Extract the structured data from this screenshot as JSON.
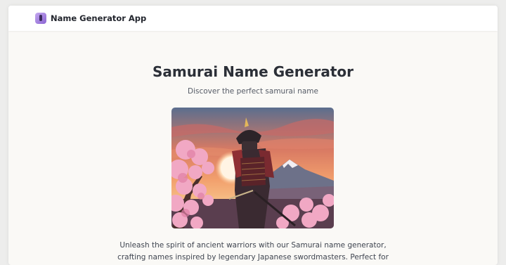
{
  "app": {
    "brand_name": "Name Generator App",
    "logo_icon": "app-logo-icon"
  },
  "hero": {
    "title": "Samurai Name Generator",
    "subtitle": "Discover the perfect samurai name",
    "image_subject": "samurai-sunset-illustration"
  },
  "intro": {
    "text": "Unleash the spirit of ancient warriors with our Samurai name generator, crafting names inspired by legendary Japanese swordmasters. Perfect for"
  },
  "colors": {
    "background": "#faf9f6",
    "brand_text": "#23262e",
    "accent": "#8a63d2"
  }
}
